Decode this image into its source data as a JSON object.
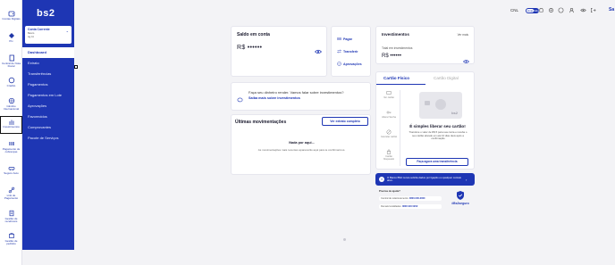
{
  "rail": [
    {
      "label": "Contas Digitais",
      "icon": "wallet-icon"
    },
    {
      "label": "Pix",
      "icon": "pix-icon"
    },
    {
      "label": "Central de Nota Fiscal",
      "icon": "document-icon"
    },
    {
      "label": "Crédito",
      "icon": "coin-icon"
    },
    {
      "label": "Câmbio Internacional",
      "icon": "globe-icon"
    },
    {
      "label": "Investimentos",
      "icon": "chart-icon"
    },
    {
      "label": "Pagamento de cobranças",
      "icon": "barcode-icon"
    },
    {
      "label": "Seguro Auto",
      "icon": "car-icon"
    },
    {
      "label": "Link de Pagamento",
      "icon": "link-icon"
    },
    {
      "label": "Gestão de recebíveis",
      "icon": "receipt-icon"
    },
    {
      "label": "Gestão de pedidos",
      "icon": "box-icon"
    }
  ],
  "sidebar": {
    "logo": "bs2",
    "account": {
      "title": "Conta Corrente",
      "row1": "Banco",
      "row2": "Ag   Cc",
      "chevron": "⌄"
    },
    "menu": [
      "Dashboard",
      "Extrato",
      "Transferências",
      "Pagamentos",
      "Pagamentos em Lote",
      "Aprovações",
      "Favorecidos",
      "Comprovantes",
      "Pacote de Serviços"
    ]
  },
  "topbar": {
    "cnl": "CNL",
    "user": "Sa",
    "toggle_left": "Hoje",
    "toggle_right": "Mês"
  },
  "saldo": {
    "title": "Saldo em conta",
    "value": "R$ ••••••"
  },
  "actions": [
    {
      "label": "Pagar",
      "icon": "barcode-icon"
    },
    {
      "label": "Transferir",
      "icon": "transfer-icon"
    },
    {
      "label": "Aprovações",
      "icon": "check-icon"
    }
  ],
  "investimentos": {
    "title": "Investimentos",
    "more": "Ver mais",
    "sub": "Total em investimentos",
    "value": "R$ ••••••"
  },
  "promo": {
    "text": "Faça seu dinheiro render. Vamos falar sobre investimentos?",
    "link": "Saiba mais sobre investimentos"
  },
  "movimentacoes": {
    "title": "Últimas movimentações",
    "button": "Ver extrato completo",
    "empty_title": "Nada por aqui...",
    "empty_text": "As movimentações mais recentes aparecerão aqui para te confirmarmos."
  },
  "cartao": {
    "tab_fisico": "Cartão Físico",
    "tab_digital": "Cartão Digital",
    "options": [
      {
        "label": "Ver cartão",
        "icon": "card-icon"
      },
      {
        "label": "Alterar Senha",
        "icon": "key-icon"
      },
      {
        "label": "Cancelar cartão",
        "icon": "cancel-icon"
      },
      {
        "label": "Cartão bloqueado",
        "icon": "lock-icon"
      }
    ],
    "card_brand": "bs2",
    "headline": "É simples liberar seu cartão!",
    "description": "Transfere o valor de R$ 5 para sua conta e receba o seu cartão ativado em até 10 dias úteis após a confirmação",
    "button": "Faça agora uma transferência"
  },
  "banner": {
    "text": "O Banco BS2 nunca solicita dados por ligação ou qualquer contato ativo.",
    "icon": "info-icon"
  },
  "help": {
    "title": "Precisa de ajuda?",
    "row1_label": "Central de relacionamento:",
    "row1_value": "0800-000-0000",
    "row2_label": "Demais localidades:",
    "row2_value": "0800 940 0202"
  },
  "tagline": {
    "text": "#Bs2seguro"
  }
}
